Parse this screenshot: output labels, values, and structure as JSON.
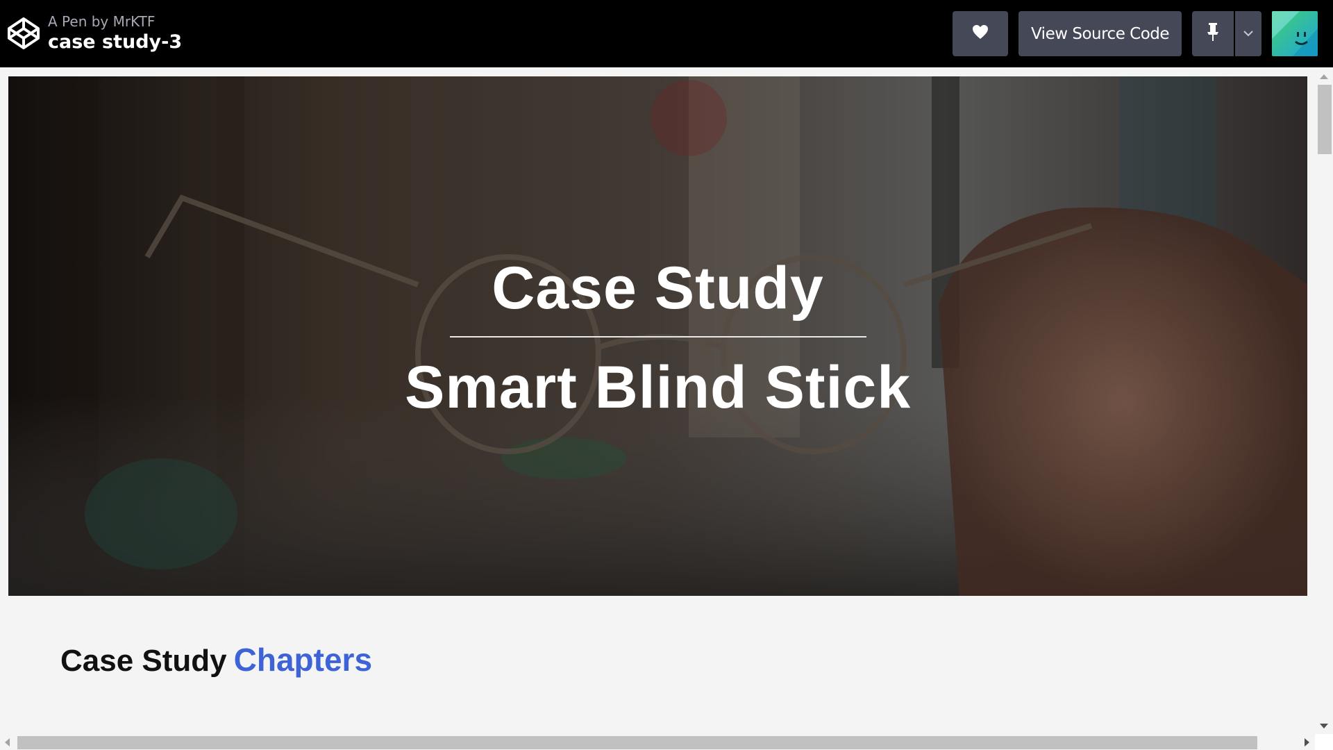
{
  "header": {
    "pen_by": "A Pen by MrKTF",
    "pen_title": "case study-3",
    "view_source_label": "View Source Code",
    "icons": {
      "logo": "codepen-logo-icon",
      "like": "heart-icon",
      "pin": "pin-icon",
      "menu": "chevron-down-icon",
      "avatar": "user-avatar"
    }
  },
  "hero": {
    "line1": "Case Study",
    "line2": "Smart Blind Stick"
  },
  "section": {
    "heading": "Case Study",
    "heading_accent": "Chapters",
    "accent_color": "#3e63d6"
  }
}
